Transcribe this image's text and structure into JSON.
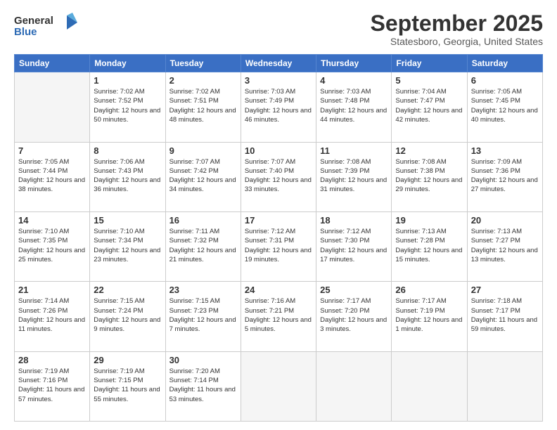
{
  "header": {
    "logo_line1": "General",
    "logo_line2": "Blue",
    "title": "September 2025",
    "location": "Statesboro, Georgia, United States"
  },
  "calendar": {
    "days_of_week": [
      "Sunday",
      "Monday",
      "Tuesday",
      "Wednesday",
      "Thursday",
      "Friday",
      "Saturday"
    ],
    "weeks": [
      [
        {
          "day": "",
          "info": ""
        },
        {
          "day": "1",
          "info": "Sunrise: 7:02 AM\nSunset: 7:52 PM\nDaylight: 12 hours\nand 50 minutes."
        },
        {
          "day": "2",
          "info": "Sunrise: 7:02 AM\nSunset: 7:51 PM\nDaylight: 12 hours\nand 48 minutes."
        },
        {
          "day": "3",
          "info": "Sunrise: 7:03 AM\nSunset: 7:49 PM\nDaylight: 12 hours\nand 46 minutes."
        },
        {
          "day": "4",
          "info": "Sunrise: 7:03 AM\nSunset: 7:48 PM\nDaylight: 12 hours\nand 44 minutes."
        },
        {
          "day": "5",
          "info": "Sunrise: 7:04 AM\nSunset: 7:47 PM\nDaylight: 12 hours\nand 42 minutes."
        },
        {
          "day": "6",
          "info": "Sunrise: 7:05 AM\nSunset: 7:45 PM\nDaylight: 12 hours\nand 40 minutes."
        }
      ],
      [
        {
          "day": "7",
          "info": "Sunrise: 7:05 AM\nSunset: 7:44 PM\nDaylight: 12 hours\nand 38 minutes."
        },
        {
          "day": "8",
          "info": "Sunrise: 7:06 AM\nSunset: 7:43 PM\nDaylight: 12 hours\nand 36 minutes."
        },
        {
          "day": "9",
          "info": "Sunrise: 7:07 AM\nSunset: 7:42 PM\nDaylight: 12 hours\nand 34 minutes."
        },
        {
          "day": "10",
          "info": "Sunrise: 7:07 AM\nSunset: 7:40 PM\nDaylight: 12 hours\nand 33 minutes."
        },
        {
          "day": "11",
          "info": "Sunrise: 7:08 AM\nSunset: 7:39 PM\nDaylight: 12 hours\nand 31 minutes."
        },
        {
          "day": "12",
          "info": "Sunrise: 7:08 AM\nSunset: 7:38 PM\nDaylight: 12 hours\nand 29 minutes."
        },
        {
          "day": "13",
          "info": "Sunrise: 7:09 AM\nSunset: 7:36 PM\nDaylight: 12 hours\nand 27 minutes."
        }
      ],
      [
        {
          "day": "14",
          "info": "Sunrise: 7:10 AM\nSunset: 7:35 PM\nDaylight: 12 hours\nand 25 minutes."
        },
        {
          "day": "15",
          "info": "Sunrise: 7:10 AM\nSunset: 7:34 PM\nDaylight: 12 hours\nand 23 minutes."
        },
        {
          "day": "16",
          "info": "Sunrise: 7:11 AM\nSunset: 7:32 PM\nDaylight: 12 hours\nand 21 minutes."
        },
        {
          "day": "17",
          "info": "Sunrise: 7:12 AM\nSunset: 7:31 PM\nDaylight: 12 hours\nand 19 minutes."
        },
        {
          "day": "18",
          "info": "Sunrise: 7:12 AM\nSunset: 7:30 PM\nDaylight: 12 hours\nand 17 minutes."
        },
        {
          "day": "19",
          "info": "Sunrise: 7:13 AM\nSunset: 7:28 PM\nDaylight: 12 hours\nand 15 minutes."
        },
        {
          "day": "20",
          "info": "Sunrise: 7:13 AM\nSunset: 7:27 PM\nDaylight: 12 hours\nand 13 minutes."
        }
      ],
      [
        {
          "day": "21",
          "info": "Sunrise: 7:14 AM\nSunset: 7:26 PM\nDaylight: 12 hours\nand 11 minutes."
        },
        {
          "day": "22",
          "info": "Sunrise: 7:15 AM\nSunset: 7:24 PM\nDaylight: 12 hours\nand 9 minutes."
        },
        {
          "day": "23",
          "info": "Sunrise: 7:15 AM\nSunset: 7:23 PM\nDaylight: 12 hours\nand 7 minutes."
        },
        {
          "day": "24",
          "info": "Sunrise: 7:16 AM\nSunset: 7:21 PM\nDaylight: 12 hours\nand 5 minutes."
        },
        {
          "day": "25",
          "info": "Sunrise: 7:17 AM\nSunset: 7:20 PM\nDaylight: 12 hours\nand 3 minutes."
        },
        {
          "day": "26",
          "info": "Sunrise: 7:17 AM\nSunset: 7:19 PM\nDaylight: 12 hours\nand 1 minute."
        },
        {
          "day": "27",
          "info": "Sunrise: 7:18 AM\nSunset: 7:17 PM\nDaylight: 11 hours\nand 59 minutes."
        }
      ],
      [
        {
          "day": "28",
          "info": "Sunrise: 7:19 AM\nSunset: 7:16 PM\nDaylight: 11 hours\nand 57 minutes."
        },
        {
          "day": "29",
          "info": "Sunrise: 7:19 AM\nSunset: 7:15 PM\nDaylight: 11 hours\nand 55 minutes."
        },
        {
          "day": "30",
          "info": "Sunrise: 7:20 AM\nSunset: 7:14 PM\nDaylight: 11 hours\nand 53 minutes."
        },
        {
          "day": "",
          "info": ""
        },
        {
          "day": "",
          "info": ""
        },
        {
          "day": "",
          "info": ""
        },
        {
          "day": "",
          "info": ""
        }
      ]
    ]
  }
}
